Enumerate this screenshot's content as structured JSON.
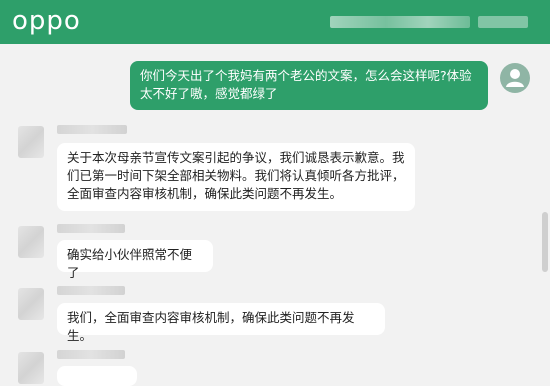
{
  "header": {
    "brand": "oppo",
    "brand_color": "#2e9f6a"
  },
  "messages": [
    {
      "direction": "outgoing",
      "text": "你们今天出了个我妈有两个老公的文案，怎么会这样呢?体验\n太不好了嗷，感觉都绿了"
    },
    {
      "direction": "incoming",
      "text": "关于本次母亲节宣传文案引起的争议，我们诚恳表示歉意。我\n们已第一时间下架全部相关物料。我们将认真倾听各方批评，\n全面审查内容审核机制，确保此类问题不再发生。"
    },
    {
      "direction": "incoming",
      "text": "确实给小伙伴照常不便了"
    },
    {
      "direction": "incoming",
      "text": "我们，全面审查内容审核机制，确保此类问题不再发生。"
    }
  ],
  "icons": {
    "user_avatar": "person-icon"
  }
}
